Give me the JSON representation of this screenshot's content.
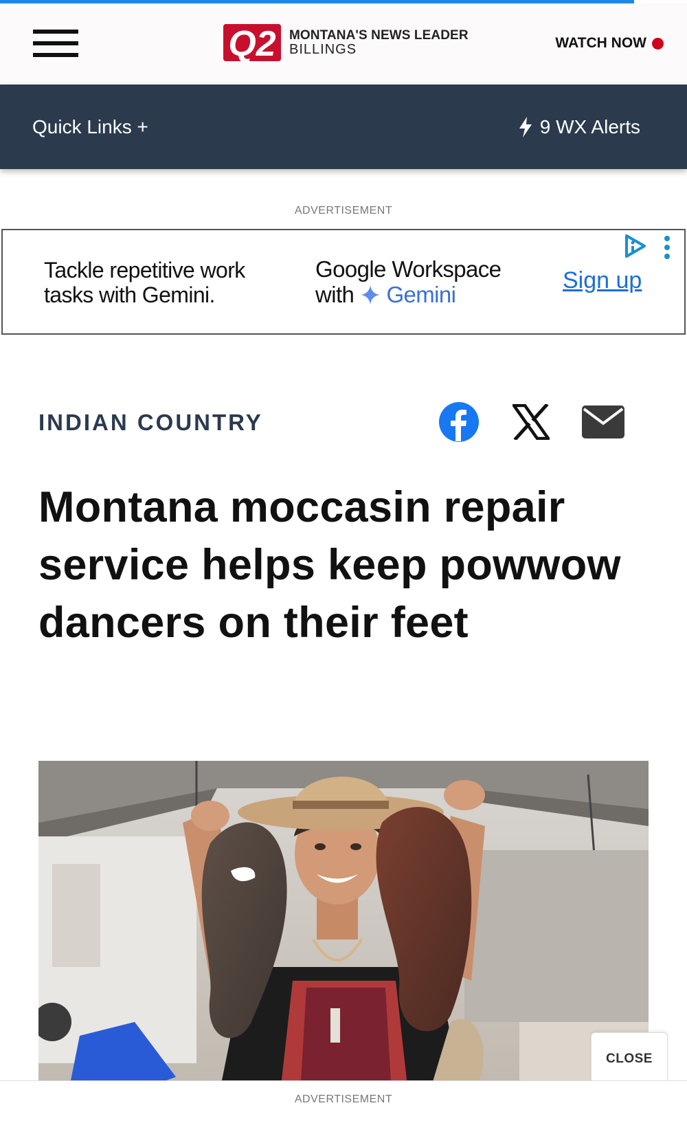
{
  "progress": {
    "fraction": 0.923,
    "color": "#1e88e5"
  },
  "header": {
    "logo_mark": "Q2",
    "logo_line1": "MONTANA'S NEWS LEADER",
    "logo_line2": "BILLINGS",
    "watch_now": "WATCH NOW",
    "menu_icon": "hamburger-menu-icon",
    "live_color": "#d0021b"
  },
  "navbar": {
    "quick_links": "Quick Links +",
    "wx_alerts": "9 WX Alerts",
    "wx_icon": "lightning-bolt-icon",
    "background": "#2b3a4d"
  },
  "ad_top": {
    "label": "ADVERTISEMENT",
    "text1": "Tackle repetitive work tasks with Gemini.",
    "text2_line1": "Google Workspace",
    "text2_with": "with",
    "text2_gemini": "Gemini",
    "signup": "Sign up",
    "adchoices_icon": "adchoices-icon",
    "options_icon": "more-options-icon"
  },
  "article": {
    "category": "INDIAN COUNTRY",
    "headline": "Montana moccasin repair service helps keep powwow dancers on their feet",
    "share_icons": [
      "facebook-icon",
      "x-icon",
      "email-icon"
    ],
    "photo": "woman-holding-moccasin-soles-photo"
  },
  "bottom_ad": {
    "label": "ADVERTISEMENT",
    "close": "CLOSE"
  }
}
